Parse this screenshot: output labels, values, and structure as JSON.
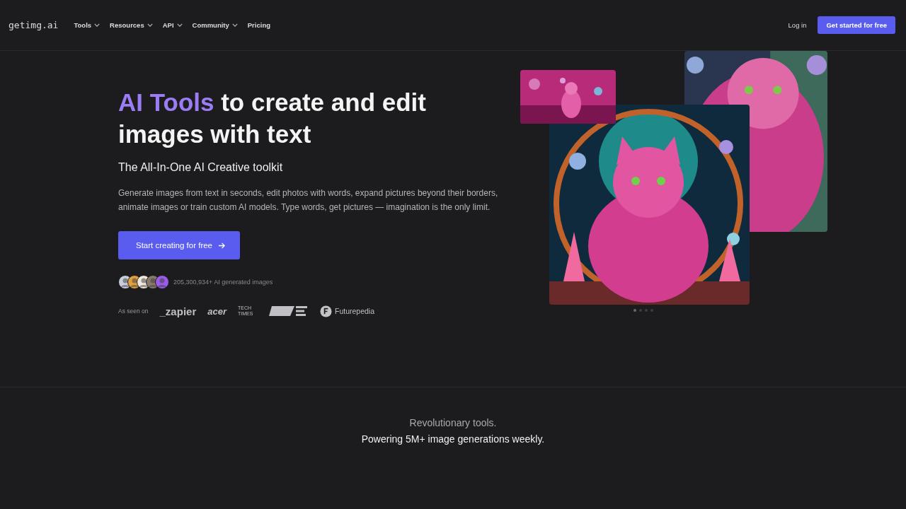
{
  "nav": {
    "logo": "getimg.ai",
    "menu": [
      {
        "label": "Tools",
        "dropdown": true
      },
      {
        "label": "Resources",
        "dropdown": true
      },
      {
        "label": "API",
        "dropdown": true
      },
      {
        "label": "Community",
        "dropdown": true
      },
      {
        "label": "Pricing",
        "dropdown": false
      }
    ],
    "login": "Log in",
    "cta": "Get started for free"
  },
  "hero": {
    "title_highlight": "AI Tools",
    "title_rest": "to create and edit images with text",
    "subtitle": "The All-In-One AI Creative toolkit",
    "description": "Generate images from text in seconds, edit photos with words, expand pictures beyond their borders, animate images or train custom AI models. Type words, get pictures — imagination is the only limit.",
    "button": "Start creating for free",
    "stats": "205,300,934+ AI generated images",
    "seen_on": "As seen on",
    "logos": [
      {
        "kind": "text",
        "text": "_zapier"
      },
      {
        "kind": "text",
        "text": "acer"
      },
      {
        "kind": "text",
        "text": "TECH TIMES"
      },
      {
        "kind": "shape"
      },
      {
        "kind": "circle",
        "text": "Futurepedia"
      }
    ],
    "slides": [
      {
        "selected": true
      },
      {
        "selected": false
      },
      {
        "selected": false
      },
      {
        "selected": false
      }
    ]
  },
  "section": {
    "kicker": "Revolutionary tools.",
    "headline": "Powering 5M+ image generations weekly."
  }
}
